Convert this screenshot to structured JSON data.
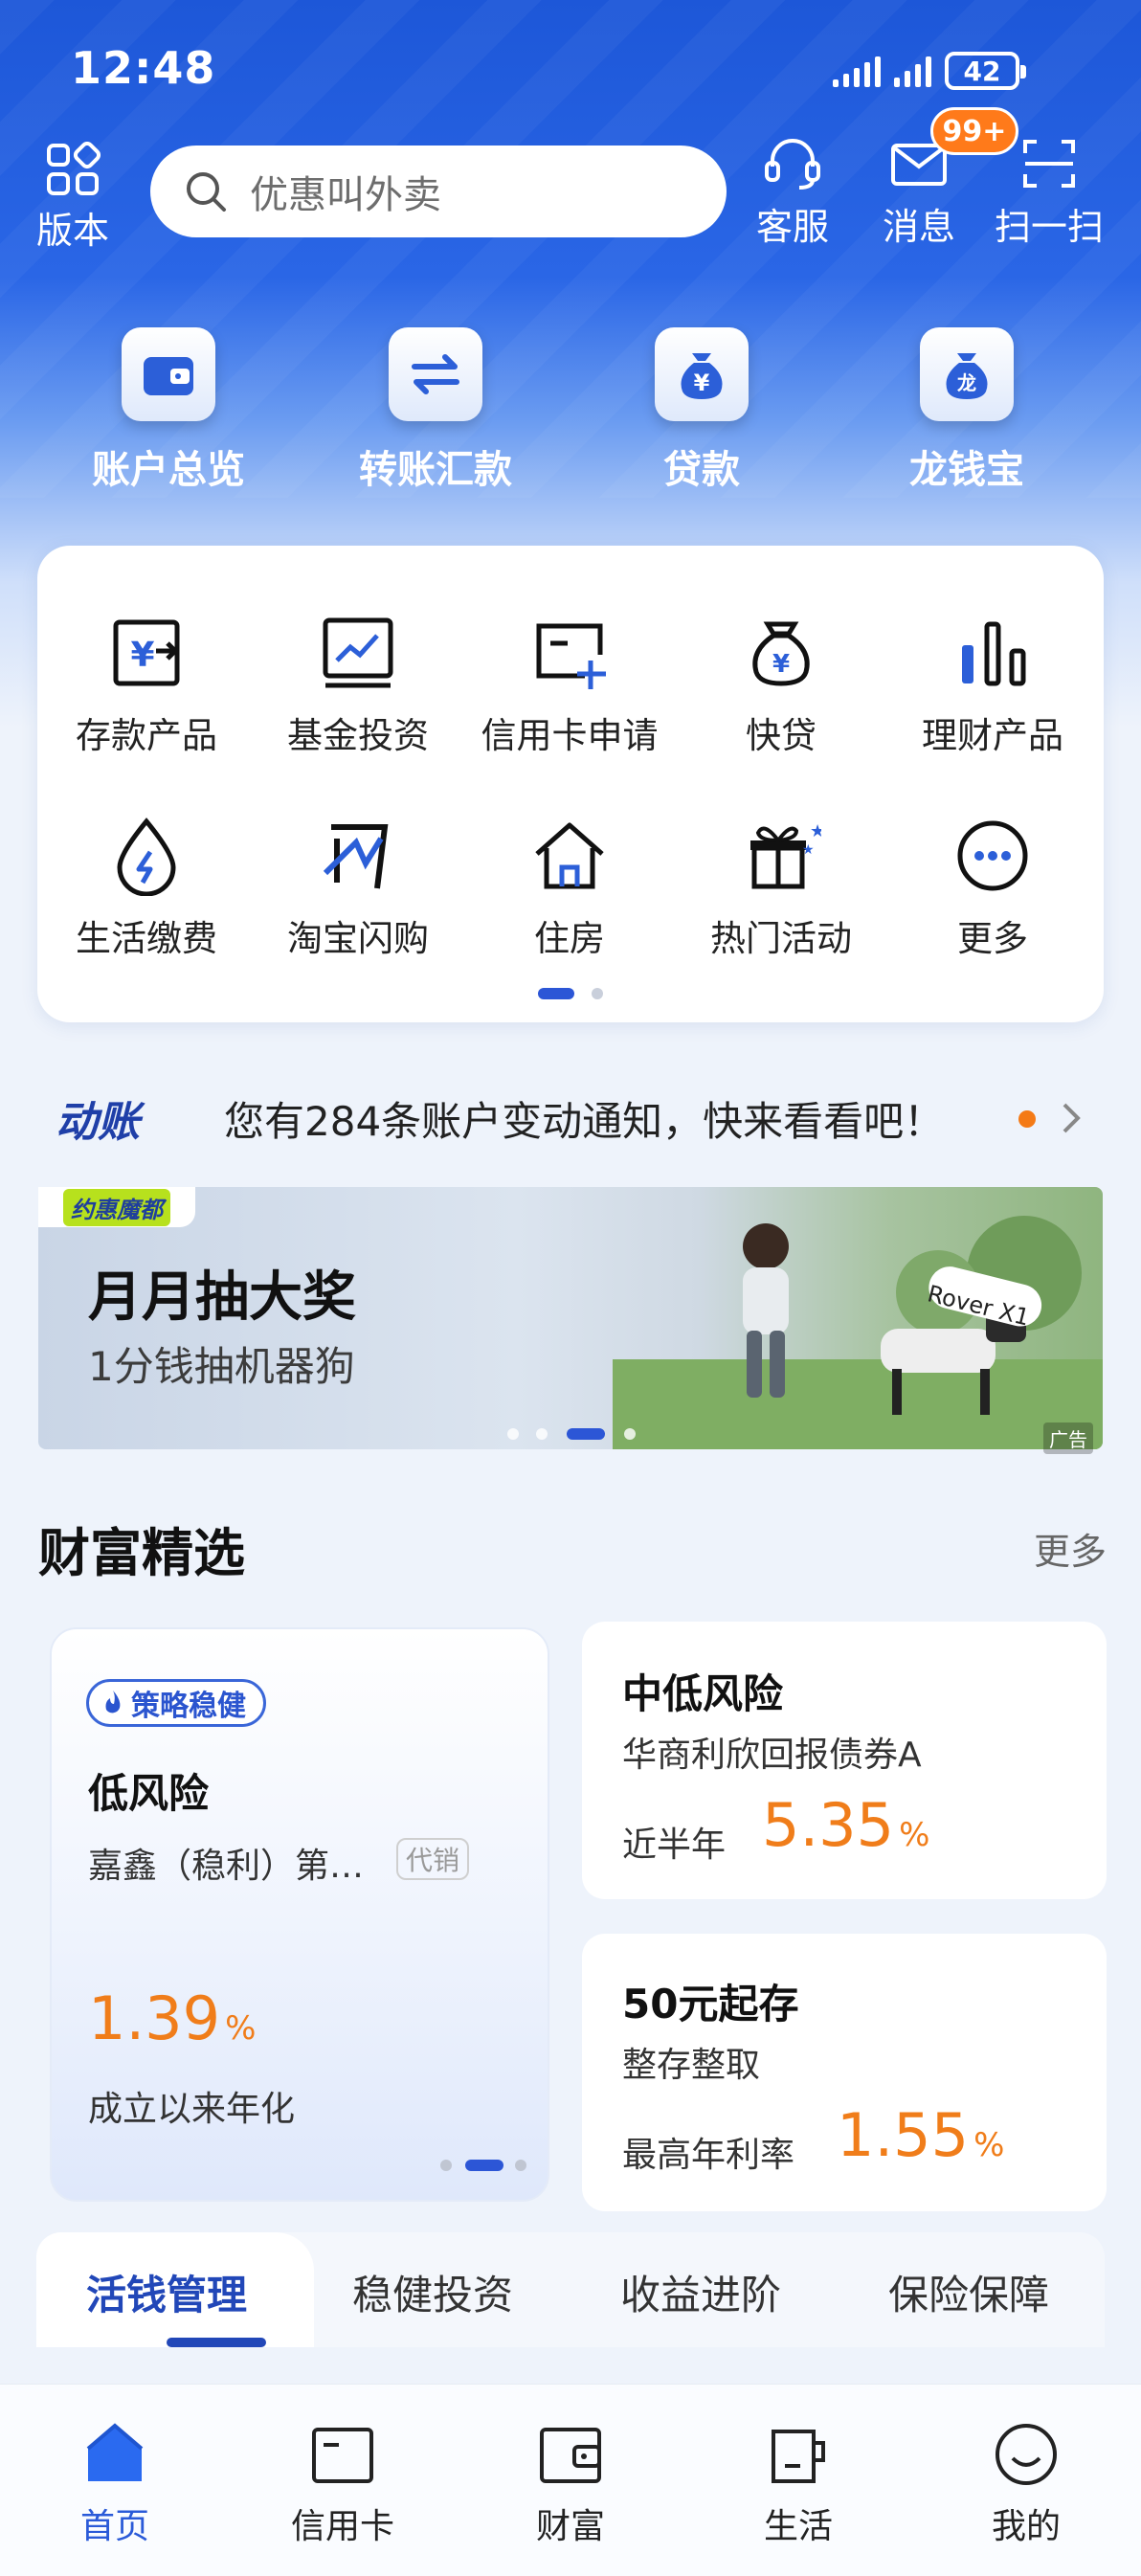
{
  "status": {
    "time": "12:48",
    "battery": "42"
  },
  "header": {
    "version_label": "版本",
    "search_placeholder": "优惠叫外卖",
    "service_label": "客服",
    "message_label": "消息",
    "message_badge": "99+",
    "scan_label": "扫一扫"
  },
  "quick_actions": [
    {
      "label": "账户总览",
      "icon": "wallet-icon"
    },
    {
      "label": "转账汇款",
      "icon": "transfer-icon"
    },
    {
      "label": "贷款",
      "icon": "money-bag-icon",
      "glyph": "¥"
    },
    {
      "label": "龙钱宝",
      "icon": "dragon-bag-icon",
      "glyph": "龙"
    }
  ],
  "services": [
    {
      "label": "存款产品",
      "icon": "deposit-icon"
    },
    {
      "label": "基金投资",
      "icon": "fund-chart-icon"
    },
    {
      "label": "信用卡申请",
      "icon": "credit-card-add-icon"
    },
    {
      "label": "快贷",
      "icon": "money-bag-icon"
    },
    {
      "label": "理财产品",
      "icon": "bar-chart-icon"
    },
    {
      "label": "生活缴费",
      "icon": "water-drop-icon"
    },
    {
      "label": "淘宝闪购",
      "icon": "flash-buy-icon"
    },
    {
      "label": "住房",
      "icon": "house-icon"
    },
    {
      "label": "热门活动",
      "icon": "gift-icon"
    },
    {
      "label": "更多",
      "icon": "more-icon"
    }
  ],
  "notice": {
    "logo_text": "动账",
    "text": "您有284条账户变动通知，快来看看吧！"
  },
  "banner": {
    "tag": "约惠魔都",
    "title": "月月抽大奖",
    "subtitle": "1分钱抽机器狗",
    "robot_label": "Rover X1",
    "ad_label": "广告",
    "active_dot": 2,
    "dot_count": 4
  },
  "wealth": {
    "title": "财富精选",
    "more": "更多",
    "featured": {
      "chip": "策略稳健",
      "risk": "低风险",
      "product": "嘉鑫（稳利）第…",
      "tag": "代销",
      "rate": "1.39",
      "pct": "%",
      "rate_label": "成立以来年化"
    },
    "card_a": {
      "risk": "中低风险",
      "product": "华商利欣回报债券A",
      "rate_label": "近半年",
      "rate": "5.35",
      "pct": "%"
    },
    "card_b": {
      "title": "50元起存",
      "product": "整存整取",
      "rate_label": "最高年利率",
      "rate": "1.55",
      "pct": "%"
    }
  },
  "tabs": [
    "活钱管理",
    "稳健投资",
    "收益进阶",
    "保险保障"
  ],
  "bottom_nav": [
    {
      "label": "首页",
      "icon": "home-icon",
      "active": true
    },
    {
      "label": "信用卡",
      "icon": "credit-card-icon",
      "active": false
    },
    {
      "label": "财富",
      "icon": "wallet-icon",
      "active": false
    },
    {
      "label": "生活",
      "icon": "cup-icon",
      "active": false
    },
    {
      "label": "我的",
      "icon": "smile-icon",
      "active": false
    }
  ],
  "colors": {
    "primary": "#2a5ad8",
    "accent": "#f07d1a",
    "hero": "#1d57d8"
  }
}
